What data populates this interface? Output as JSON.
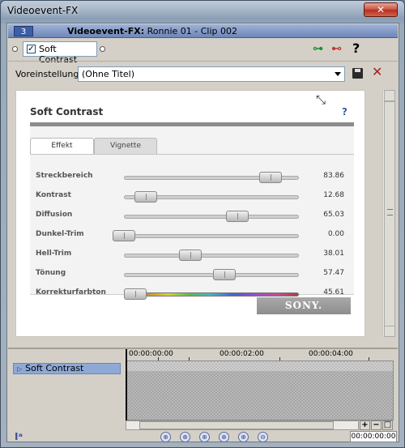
{
  "window": {
    "title": "Videoevent-FX",
    "close_label": "✕"
  },
  "event": {
    "track_number": "3",
    "title_bold": "Videoevent-FX:",
    "title_rest": " Ronnie 01 - Clip 002"
  },
  "chain": {
    "fx_label": "Soft Contrast",
    "fx_checked": "✓",
    "help": "?"
  },
  "preset": {
    "label": "Voreinstellung:",
    "value": "(Ohne Titel)"
  },
  "plugin": {
    "title": "Soft Contrast",
    "help": "?",
    "tabs": [
      "Effekt",
      "Vignette"
    ],
    "brand": "SONY.",
    "params": [
      {
        "name": "Streckbereich",
        "value": "83.86",
        "fraction": 0.8386
      },
      {
        "name": "Kontrast",
        "value": "12.68",
        "fraction": 0.1268
      },
      {
        "name": "Diffusion",
        "value": "65.03",
        "fraction": 0.6503
      },
      {
        "name": "Dunkel-Trim",
        "value": "0.00",
        "fraction": 0.0
      },
      {
        "name": "Hell-Trim",
        "value": "38.01",
        "fraction": 0.3801
      },
      {
        "name": "Tönung",
        "value": "57.47",
        "fraction": 0.5747
      },
      {
        "name": "Korrekturfarbton",
        "value": "45.61",
        "fraction": 0.0
      }
    ]
  },
  "keyframes": {
    "item": "Soft Contrast",
    "ruler": [
      "00:00:00:00",
      "00:00:02:00",
      "00:00:04:00"
    ],
    "time": "00:00:00:00"
  },
  "colors": {
    "accent": "#3b5da8",
    "track_blue": "#3d5fa8"
  }
}
